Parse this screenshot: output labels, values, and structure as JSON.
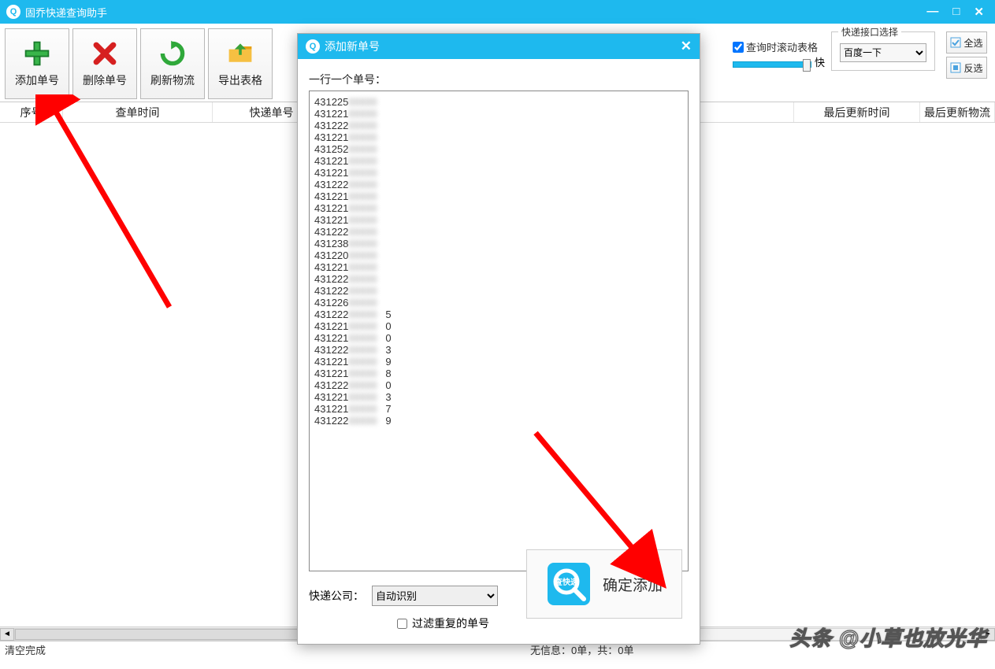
{
  "window": {
    "title": "固乔快递查询助手"
  },
  "toolbar": {
    "add": "添加单号",
    "delete": "删除单号",
    "refresh": "刷新物流",
    "export": "导出表格"
  },
  "options": {
    "scroll_label": "查询时滚动表格",
    "speed_fast": "快",
    "api_group": "快递接口选择",
    "api_selected": "百度一下",
    "select_all": "全选",
    "invert": "反选"
  },
  "columns": {
    "seq": "序号",
    "time": "查单时间",
    "no": "快递单号",
    "update": "最后更新时间",
    "logi": "最后更新物流"
  },
  "status": {
    "left": "清空完成",
    "mid": "无信息：0单，共：0单"
  },
  "dialog": {
    "title": "添加新单号",
    "hint": "一行一个单号：",
    "company_label": "快递公司：",
    "company_selected": "自动识别",
    "filter_label": "过滤重复的单号",
    "confirm": "确定添加",
    "lines": [
      {
        "prefix": "431225",
        "tail": ""
      },
      {
        "prefix": "431221",
        "tail": ""
      },
      {
        "prefix": "431222",
        "tail": ""
      },
      {
        "prefix": "431221",
        "tail": ""
      },
      {
        "prefix": "431252",
        "tail": ""
      },
      {
        "prefix": "431221",
        "tail": ""
      },
      {
        "prefix": "431221",
        "tail": ""
      },
      {
        "prefix": "431222",
        "tail": ""
      },
      {
        "prefix": "431221",
        "tail": ""
      },
      {
        "prefix": "431221",
        "tail": ""
      },
      {
        "prefix": "431221",
        "tail": ""
      },
      {
        "prefix": "431222",
        "tail": ""
      },
      {
        "prefix": "431238",
        "tail": ""
      },
      {
        "prefix": "431220",
        "tail": ""
      },
      {
        "prefix": "431221",
        "tail": ""
      },
      {
        "prefix": "431222",
        "tail": ""
      },
      {
        "prefix": "431222",
        "tail": ""
      },
      {
        "prefix": "431226",
        "tail": ""
      },
      {
        "prefix": "431222",
        "tail": "5"
      },
      {
        "prefix": "431221",
        "tail": "0"
      },
      {
        "prefix": "431221",
        "tail": "0"
      },
      {
        "prefix": "431222",
        "tail": "3"
      },
      {
        "prefix": "431221",
        "tail": "9"
      },
      {
        "prefix": "431221",
        "tail": "8"
      },
      {
        "prefix": "431222",
        "tail": "0"
      },
      {
        "prefix": "431221",
        "tail": "3"
      },
      {
        "prefix": "431221",
        "tail": "7"
      },
      {
        "prefix": "431222",
        "tail": "9"
      }
    ]
  },
  "watermark": "头条 @小草也放光华"
}
